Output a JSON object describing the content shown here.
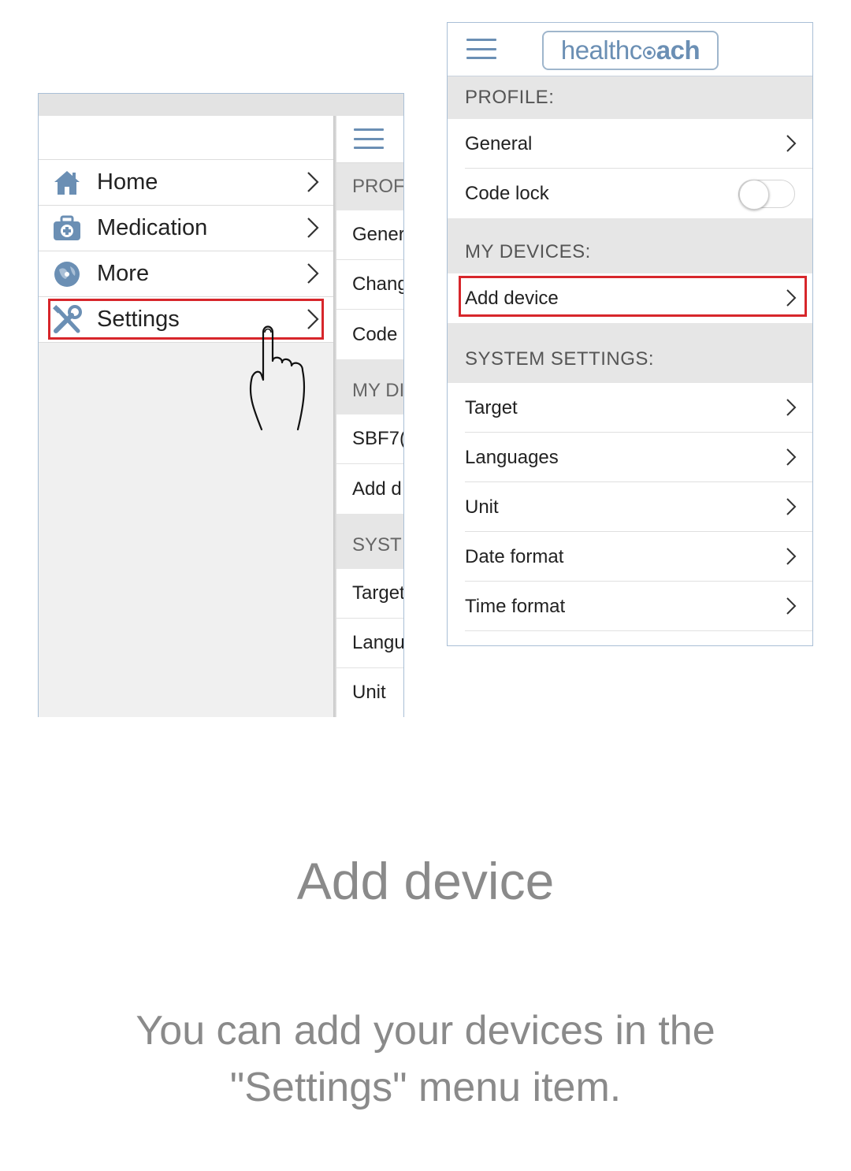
{
  "left_panel": {
    "drawer_items": [
      {
        "label": "Home",
        "icon": "home-icon"
      },
      {
        "label": "Medication",
        "icon": "medication-kit-icon"
      },
      {
        "label": "More",
        "icon": "globe-icon"
      },
      {
        "label": "Settings",
        "icon": "tools-icon"
      }
    ],
    "peek": {
      "section_profile": "PROF",
      "rows_profile": [
        "Gener",
        "Chang",
        "Code l"
      ],
      "section_devices": "MY DI",
      "rows_devices": [
        "SBF7(",
        "Add d"
      ],
      "section_system": "SYST",
      "rows_system": [
        "Target",
        "Langu",
        "Unit"
      ]
    }
  },
  "right_panel": {
    "logo": {
      "part1": "healthc",
      "part2": "ach"
    },
    "sections": {
      "profile": "PROFILE:",
      "devices": "MY DEVICES:",
      "system": "SYSTEM SETTINGS:"
    },
    "profile_rows": {
      "general": "General",
      "code_lock": "Code lock"
    },
    "code_lock_enabled": false,
    "device_rows": {
      "add_device": "Add device"
    },
    "system_rows": [
      "Target",
      "Languages",
      "Unit",
      "Date format",
      "Time format"
    ]
  },
  "caption": {
    "title": "Add device",
    "body": "You can add your devices in the \"Settings\" menu item."
  },
  "colors": {
    "accent": "#6b8fb4",
    "highlight": "#d7262b",
    "section_bg": "#e6e6e6",
    "caption_text": "#8a8a8a"
  }
}
